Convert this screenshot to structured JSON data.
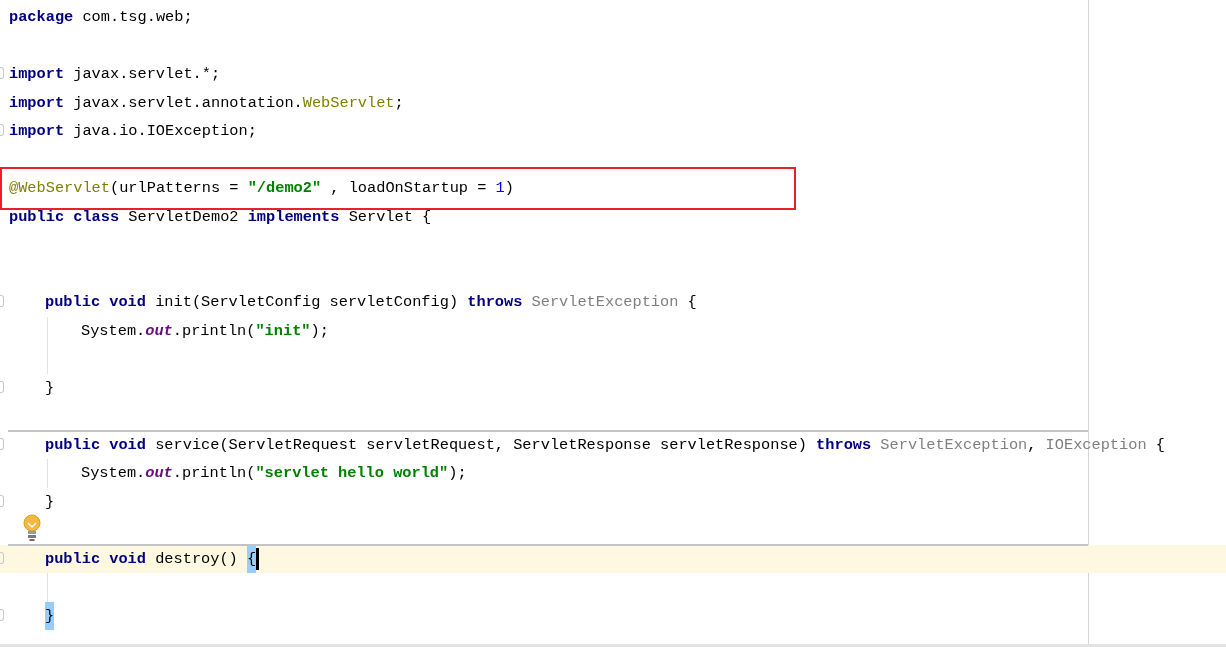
{
  "lines": [
    {
      "fold_marker": false,
      "boxed": false,
      "separator_above": false,
      "current": false,
      "bulb": false,
      "tokens": [
        {
          "kind": "keyword",
          "text": "package"
        },
        {
          "kind": "plain",
          "text": " com.tsg.web;"
        }
      ]
    },
    {
      "fold_marker": false,
      "boxed": false,
      "separator_above": false,
      "current": false,
      "bulb": false
    },
    {
      "fold_marker": true,
      "boxed": false,
      "separator_above": false,
      "current": false,
      "bulb": false,
      "tokens": [
        {
          "kind": "keyword",
          "text": "import"
        },
        {
          "kind": "plain",
          "text": " javax.servlet.*;"
        }
      ]
    },
    {
      "fold_marker": false,
      "boxed": false,
      "separator_above": false,
      "current": false,
      "bulb": false,
      "tokens": [
        {
          "kind": "keyword",
          "text": "import"
        },
        {
          "kind": "plain",
          "text": " javax.servlet.annotation."
        },
        {
          "kind": "annotation",
          "text": "WebServlet"
        },
        {
          "kind": "plain",
          "text": ";"
        }
      ]
    },
    {
      "fold_marker": true,
      "boxed": false,
      "separator_above": false,
      "current": false,
      "bulb": false,
      "tokens": [
        {
          "kind": "keyword",
          "text": "import"
        },
        {
          "kind": "plain",
          "text": " java.io.IOException;"
        }
      ]
    },
    {
      "fold_marker": false,
      "boxed": false,
      "separator_above": false,
      "current": false,
      "bulb": false
    },
    {
      "fold_marker": false,
      "boxed": true,
      "separator_above": false,
      "current": false,
      "bulb": false,
      "tokens": [
        {
          "kind": "annotation",
          "text": "@WebServlet"
        },
        {
          "kind": "plain",
          "text": "(urlPatterns = "
        },
        {
          "kind": "string",
          "text": "\"/demo2\""
        },
        {
          "kind": "plain",
          "text": " , loadOnStartup = "
        },
        {
          "kind": "number",
          "text": "1"
        },
        {
          "kind": "plain",
          "text": ")"
        }
      ]
    },
    {
      "fold_marker": false,
      "boxed": false,
      "separator_above": false,
      "current": false,
      "bulb": false,
      "tokens": [
        {
          "kind": "keyword",
          "text": "public class"
        },
        {
          "kind": "plain",
          "text": " ServletDemo2 "
        },
        {
          "kind": "keyword",
          "text": "implements"
        },
        {
          "kind": "plain",
          "text": " Servlet {"
        }
      ],
      "children": [
        {
          "fold_marker": false,
          "boxed": false,
          "separator_above": false,
          "current": false,
          "bulb": false
        },
        {
          "fold_marker": false,
          "boxed": false,
          "separator_above": false,
          "current": false,
          "bulb": false
        },
        {
          "fold_marker": true,
          "boxed": false,
          "separator_above": false,
          "current": false,
          "bulb": false,
          "tokens": [
            {
              "kind": "keyword",
              "text": "public void"
            },
            {
              "kind": "plain",
              "text": " init(ServletConfig servletConfig) "
            },
            {
              "kind": "keyword",
              "text": "throws"
            },
            {
              "kind": "unused",
              "text": " ServletException"
            },
            {
              "kind": "plain",
              "text": " {"
            }
          ],
          "children": [
            {
              "fold_marker": false,
              "boxed": false,
              "separator_above": false,
              "current": false,
              "bulb": false,
              "tokens": [
                {
                  "kind": "plain",
                  "text": "System."
                },
                {
                  "kind": "field",
                  "text": "out"
                },
                {
                  "kind": "plain",
                  "text": ".println("
                },
                {
                  "kind": "string",
                  "text": "\"init\""
                },
                {
                  "kind": "plain",
                  "text": ");"
                }
              ]
            },
            {
              "fold_marker": false,
              "boxed": false,
              "separator_above": false,
              "current": false,
              "bulb": false
            }
          ]
        },
        {
          "fold_marker": true,
          "boxed": false,
          "separator_above": false,
          "current": false,
          "bulb": false,
          "tokens": [
            {
              "kind": "plain",
              "text": "}"
            }
          ]
        },
        {
          "fold_marker": false,
          "boxed": false,
          "separator_above": false,
          "current": false,
          "bulb": false
        },
        {
          "fold_marker": true,
          "boxed": false,
          "separator_above": true,
          "current": false,
          "bulb": false,
          "tokens": [
            {
              "kind": "keyword",
              "text": "public void"
            },
            {
              "kind": "plain",
              "text": " service(ServletRequest servletRequest, ServletResponse servletResponse) "
            },
            {
              "kind": "keyword",
              "text": "throws"
            },
            {
              "kind": "unused",
              "text": " ServletException"
            },
            {
              "kind": "plain",
              "text": ", "
            },
            {
              "kind": "unused",
              "text": "IOException"
            },
            {
              "kind": "plain",
              "text": " {"
            }
          ],
          "children": [
            {
              "fold_marker": false,
              "boxed": false,
              "separator_above": false,
              "current": false,
              "bulb": false,
              "tokens": [
                {
                  "kind": "plain",
                  "text": "System."
                },
                {
                  "kind": "field",
                  "text": "out"
                },
                {
                  "kind": "plain",
                  "text": ".println("
                },
                {
                  "kind": "string",
                  "text": "\"servlet hello world\""
                },
                {
                  "kind": "plain",
                  "text": ");"
                }
              ]
            }
          ]
        },
        {
          "fold_marker": true,
          "boxed": false,
          "separator_above": false,
          "current": false,
          "bulb": false,
          "tokens": [
            {
              "kind": "plain",
              "text": "}"
            }
          ]
        },
        {
          "fold_marker": false,
          "boxed": false,
          "separator_above": false,
          "current": false,
          "bulb": true
        },
        {
          "fold_marker": true,
          "boxed": false,
          "separator_above": true,
          "current": true,
          "bulb": false,
          "tokens": [
            {
              "kind": "keyword",
              "text": "public void"
            },
            {
              "kind": "plain",
              "text": " destroy() "
            },
            {
              "kind": "brace-match",
              "text": "{"
            }
          ],
          "children": [
            {
              "fold_marker": false,
              "boxed": false,
              "separator_above": false,
              "current": false,
              "bulb": false
            }
          ]
        },
        {
          "fold_marker": true,
          "boxed": false,
          "separator_above": false,
          "current": false,
          "bulb": false,
          "tokens": [
            {
              "kind": "brace-match",
              "text": "}"
            }
          ]
        }
      ]
    }
  ]
}
